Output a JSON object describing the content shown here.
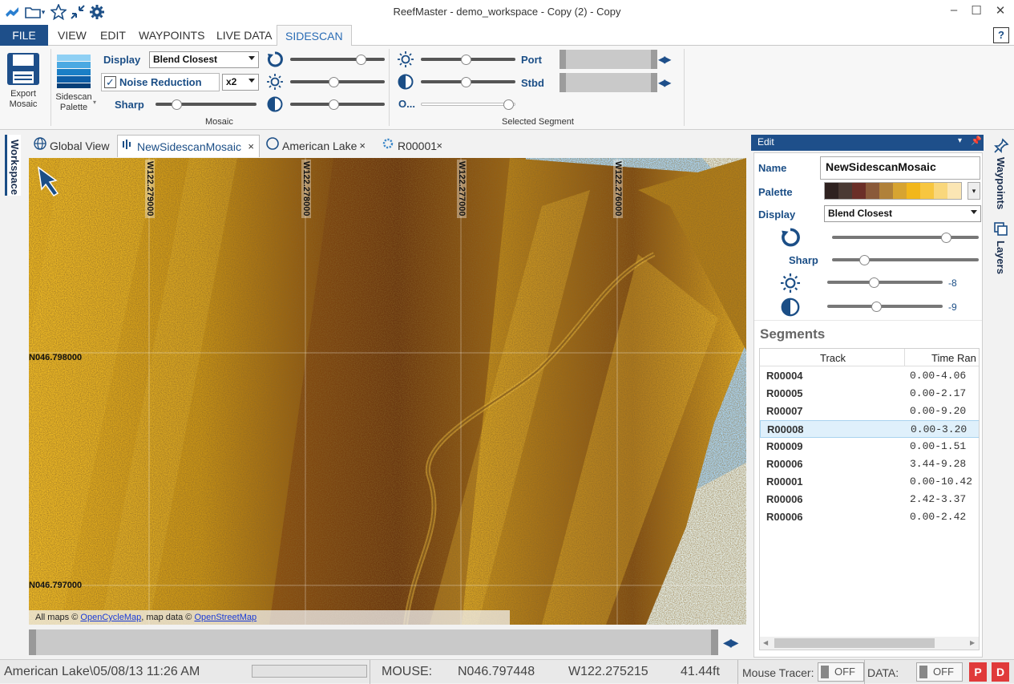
{
  "app": {
    "title": "ReefMaster - demo_workspace - Copy (2) - Copy",
    "window_controls": [
      "–",
      "☐",
      "✕"
    ]
  },
  "ribbon_tabs": [
    "FILE",
    "VIEW",
    "EDIT",
    "WAYPOINTS",
    "LIVE DATA",
    "SIDESCAN"
  ],
  "active_ribbon_tab": "SIDESCAN",
  "help_label": "?",
  "ribbon": {
    "export_label_1": "Export",
    "export_label_2": "Mosaic",
    "palette_label_1": "Sidescan",
    "palette_label_2": "Palette",
    "display_label": "Display",
    "display_value": "Blend Closest",
    "noise_label": "Noise Reduction",
    "noise_checked": true,
    "noise_factor": "x2",
    "sharp_label": "Sharp",
    "mosaic_group": "Mosaic",
    "port_label": "Port",
    "stbd_label": "Stbd",
    "opacity_label": "O...",
    "segment_group": "Selected Segment",
    "sliders": {
      "sharp": 0.18,
      "rotate": 0.78,
      "brightness": 0.46,
      "contrast": 0.46,
      "seg_brightness": 0.48,
      "seg_contrast": 0.48,
      "seg_opacity": 0.98
    }
  },
  "sidebar_left": {
    "workspace_label": "Workspace"
  },
  "doc_tabs": [
    {
      "label": "Global View",
      "icon": "globe-icon",
      "closable": false
    },
    {
      "label": "NewSidescanMosaic",
      "icon": "sidescan-icon",
      "closable": true,
      "active": true
    },
    {
      "label": "American Lake",
      "icon": "compass-icon",
      "closable": true
    },
    {
      "label": "R00001",
      "icon": "gear-icon",
      "closable": true
    }
  ],
  "close_glyph": "×",
  "map": {
    "lon_labels": [
      "W122.279000",
      "W122.278000",
      "W122.277000",
      "W122.276000"
    ],
    "lat_labels": [
      "N046.798000",
      "N046.797000"
    ],
    "credits_prefix": "All maps © ",
    "credits_link1": "OpenCycleMap",
    "credits_mid": ", map data © ",
    "credits_link2": "OpenStreetMap"
  },
  "edit_panel": {
    "header": "Edit",
    "name_label": "Name",
    "name_value": "NewSidescanMosaic",
    "palette_label": "Palette",
    "palette_colors": [
      "#2f2220",
      "#4a3a34",
      "#6b2f28",
      "#8a5a3a",
      "#b0813a",
      "#d7a431",
      "#f2b71c",
      "#f7c640",
      "#f9d77c",
      "#fbe6b4"
    ],
    "display_label": "Display",
    "display_value": "Blend Closest",
    "sharp_label": "Sharp",
    "brightness_value": "-8",
    "contrast_value": "-9",
    "sliders": {
      "rotate": 0.8,
      "sharp": 0.2,
      "brightness": 0.4,
      "contrast": 0.42
    },
    "segments_title": "Segments",
    "col_track": "Track",
    "col_time": "Time Ran",
    "segments": [
      {
        "track": "R00004",
        "time": "0.00-4.06"
      },
      {
        "track": "R00005",
        "time": "0.00-2.17"
      },
      {
        "track": "R00007",
        "time": "0.00-9.20"
      },
      {
        "track": "R00008",
        "time": "0.00-3.20",
        "selected": true
      },
      {
        "track": "R00009",
        "time": "0.00-1.51"
      },
      {
        "track": "R00006",
        "time": "3.44-9.28"
      },
      {
        "track": "R00001",
        "time": "0.00-10.42"
      },
      {
        "track": "R00006",
        "time": "2.42-3.37"
      },
      {
        "track": "R00006",
        "time": "0.00-2.42"
      }
    ]
  },
  "right_rail": {
    "waypoints_label": "Waypoints",
    "layers_label": "Layers"
  },
  "status": {
    "location": "American Lake\\05/08/13 11:26 AM",
    "mouse_label": "MOUSE:",
    "mouse_lat": "N046.797448",
    "mouse_lon": "W122.275215",
    "depth": "41.44ft",
    "tracer_label": "Mouse Tracer:",
    "tracer_state": "OFF",
    "data_label": "DATA:",
    "data_state": "OFF",
    "btn_p": "P",
    "btn_d": "D"
  },
  "colors": {
    "accent": "#1e4f8a",
    "mosaic_bright": "#e9b321",
    "mosaic_dark": "#6e3a0e",
    "water": "#aad3f0",
    "land": "#e4ece5"
  }
}
